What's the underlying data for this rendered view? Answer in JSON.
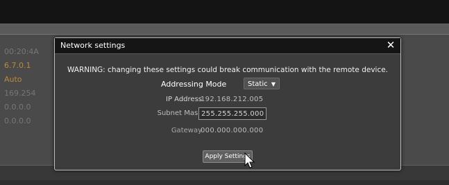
{
  "background": {
    "list_items": [
      "00:20:4A",
      "6.7.0.1",
      "Auto",
      "169.254",
      "0.0.0.0",
      "0.0.0.0"
    ]
  },
  "dialog": {
    "title": "Network settings",
    "close_icon": "close-icon",
    "warning": "WARNING: changing these settings could break communication with the remote device.",
    "addressing_mode": {
      "label": "Addressing Mode",
      "value": "Static"
    },
    "ip_address": {
      "label": "IP Address",
      "value": "192.168.212.005"
    },
    "subnet_mask": {
      "label": "Subnet Mask",
      "value": "255.255.255.000"
    },
    "gateway": {
      "label": "Gateway",
      "value": "000.000.000.000"
    },
    "apply_button": "Apply Settings"
  },
  "colors": {
    "accent": "#e0a02a",
    "dialog_bg": "#3c3c3c",
    "title_bar": "#151515"
  }
}
